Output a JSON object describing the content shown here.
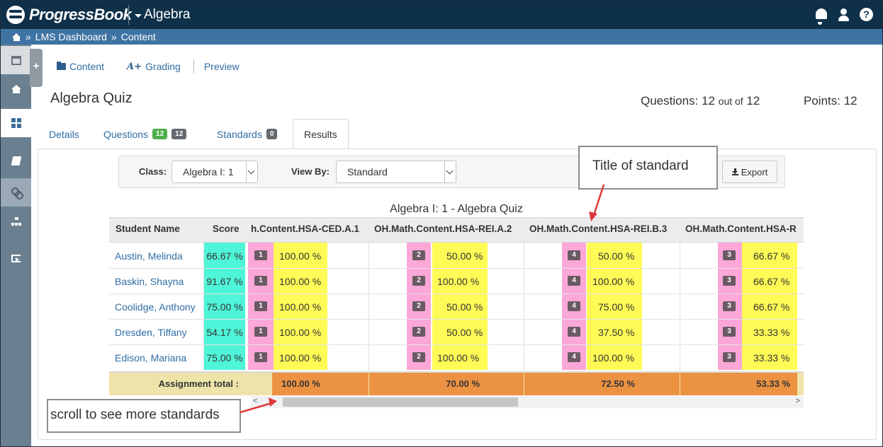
{
  "header": {
    "logo_text": "ProgressBook",
    "app_name": "Algebra",
    "icons": [
      "bell-icon",
      "user-icon",
      "help-icon"
    ],
    "help_glyph": "?"
  },
  "breadcrumb": {
    "items": [
      "LMS Dashboard",
      "Content"
    ],
    "separator": "»"
  },
  "leftnav": {
    "icons": [
      "calendar-icon",
      "home-icon",
      "dashboard-grid-icon",
      "book-icon",
      "link-icon",
      "sitemap-icon",
      "sign-out-icon"
    ],
    "expand_glyph": "+"
  },
  "top_tabs": {
    "content": "Content",
    "grading": "Grading",
    "grading_glyph": "A+",
    "preview": "Preview"
  },
  "page": {
    "title": "Algebra Quiz",
    "questions_label": "Questions:",
    "questions_count": "12",
    "out_of_label": "out of",
    "questions_total": "12",
    "points_label": "Points:",
    "points_value": "12"
  },
  "detail_tabs": {
    "details": "Details",
    "questions": "Questions",
    "questions_badge_green": "12",
    "questions_badge_gray": "12",
    "standards": "Standards",
    "standards_badge": "0",
    "results": "Results"
  },
  "filters": {
    "class_label": "Class:",
    "class_value": "Algebra I: 1",
    "view_by_label": "View By:",
    "view_by_value": "Standard",
    "export_label": "Export"
  },
  "results": {
    "caption": "Algebra I: 1 - Algebra Quiz",
    "columns": {
      "student_name": "Student Name",
      "score": "Score",
      "standards": [
        "h.Content.HSA-CED.A.1",
        "OH.Math.Content.HSA-REI.A.2",
        "OH.Math.Content.HSA-REI.B.3",
        "OH.Math.Content.HSA-R"
      ]
    },
    "rows": [
      {
        "name": "Austin, Melinda",
        "score": "66.67 %",
        "cells": [
          {
            "count": "1",
            "pct": "100.00 %"
          },
          {
            "count": "2",
            "pct": "50.00 %"
          },
          {
            "count": "4",
            "pct": "50.00 %"
          },
          {
            "count": "3",
            "pct": "66.67 %"
          }
        ]
      },
      {
        "name": "Baskin, Shayna",
        "score": "91.67 %",
        "cells": [
          {
            "count": "1",
            "pct": "100.00 %"
          },
          {
            "count": "2",
            "pct": "100.00 %"
          },
          {
            "count": "4",
            "pct": "100.00 %"
          },
          {
            "count": "3",
            "pct": "66.67 %"
          }
        ]
      },
      {
        "name": "Coolidge, Anthony",
        "score": "75.00 %",
        "cells": [
          {
            "count": "1",
            "pct": "100.00 %"
          },
          {
            "count": "2",
            "pct": "50.00 %"
          },
          {
            "count": "4",
            "pct": "75.00 %"
          },
          {
            "count": "3",
            "pct": "66.67 %"
          }
        ]
      },
      {
        "name": "Dresden, Tiffany",
        "score": "54.17 %",
        "cells": [
          {
            "count": "1",
            "pct": "100.00 %"
          },
          {
            "count": "2",
            "pct": "50.00 %"
          },
          {
            "count": "4",
            "pct": "37.50 %"
          },
          {
            "count": "3",
            "pct": "33.33 %"
          }
        ]
      },
      {
        "name": "Edison, Mariana",
        "score": "75.00 %",
        "cells": [
          {
            "count": "1",
            "pct": "100.00 %"
          },
          {
            "count": "2",
            "pct": "100.00 %"
          },
          {
            "count": "4",
            "pct": "100.00 %"
          },
          {
            "count": "3",
            "pct": "33.33 %"
          }
        ]
      }
    ],
    "total_label": "Assignment total :",
    "totals": [
      "100.00 %",
      "70.00 %",
      "72.50 %",
      "53.33 %"
    ],
    "scroll_left_glyph": "<",
    "scroll_right_glyph": ">"
  },
  "annotations": {
    "title_of_standard": "Title of standard",
    "scroll_hint": "scroll to see more standards",
    "arrow_color": "#e0383a"
  },
  "colors": {
    "topbar": "#0f3049",
    "breadcrumb_bar": "#3f73a3",
    "score_col": "#4ff5d8",
    "count_col": "#fba7d8",
    "percent_col": "#fffb56",
    "total_row": "#eee3a8",
    "total_cells": "#ec9243"
  }
}
